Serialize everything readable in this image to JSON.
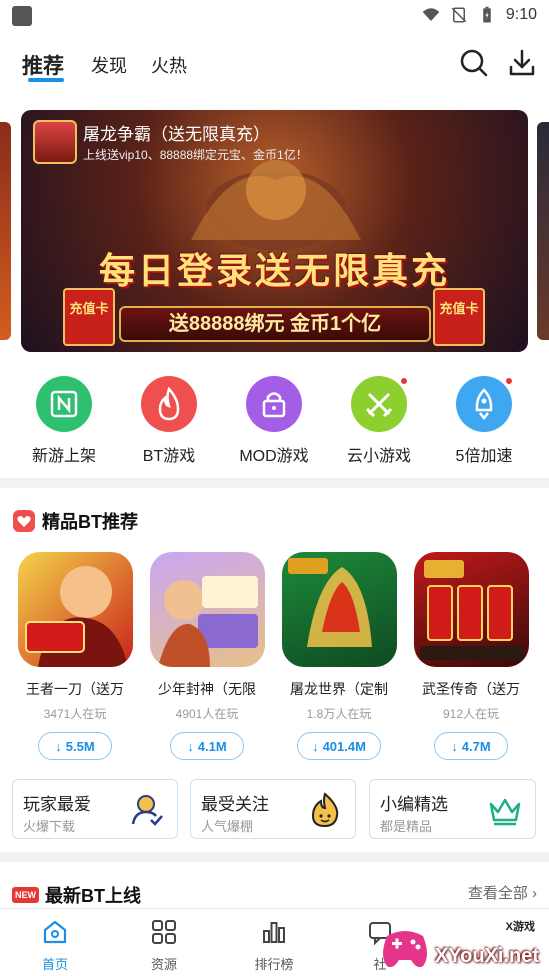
{
  "status_bar": {
    "time": "9:10",
    "icons": [
      "wifi-icon",
      "no-sim-icon",
      "battery-icon"
    ]
  },
  "top_nav": {
    "tabs": [
      {
        "label": "推荐",
        "active": true
      },
      {
        "label": "发现",
        "active": false
      },
      {
        "label": "火热",
        "active": false
      }
    ],
    "icons": [
      "search-icon",
      "download-icon"
    ]
  },
  "banner": {
    "title": "屠龙争霸（送无限真充）",
    "subtitle": "上线送vip10、88888绑定元宝、金币1亿！",
    "headline": "每日登录送无限真充",
    "strip_text": "送88888绑元 金币1个亿",
    "card_text": "充值卡"
  },
  "quick_entries": [
    {
      "label": "新游上架",
      "icon": "new-game-icon",
      "color": "#2fbf71",
      "dot": false
    },
    {
      "label": "BT游戏",
      "icon": "flame-icon",
      "color": "#ef4f4f",
      "dot": false
    },
    {
      "label": "MOD游戏",
      "icon": "lock-icon",
      "color": "#a45ee6",
      "dot": false
    },
    {
      "label": "云小游戏",
      "icon": "crossed-swords-icon",
      "color": "#8ccf2e",
      "dot": true
    },
    {
      "label": "5倍加速",
      "icon": "rocket-icon",
      "color": "#3fa7f2",
      "dot": true
    }
  ],
  "bt_section": {
    "title": "精品BT推荐",
    "games": [
      {
        "name": "王者一刀（送万",
        "players": "3471人在玩",
        "size": "5.5M",
        "colors": [
          "#f4d34a",
          "#c9231b"
        ]
      },
      {
        "name": "少年封神（无限",
        "players": "4901人在玩",
        "size": "4.1M",
        "colors": [
          "#c9a6f2",
          "#e6c08a"
        ]
      },
      {
        "name": "屠龙世界（定制",
        "players": "1.8万人在玩",
        "size": "401.4M",
        "colors": [
          "#1d8a3a",
          "#0f4a22"
        ]
      },
      {
        "name": "武圣传奇（送万",
        "players": "912人在玩",
        "size": "4.7M",
        "colors": [
          "#c01a1a",
          "#3a0a08"
        ]
      }
    ]
  },
  "feature_cards": [
    {
      "title": "玩家最爱",
      "sub": "火爆下载",
      "icon": "user-check-icon"
    },
    {
      "title": "最受关注",
      "sub": "人气爆棚",
      "icon": "smiley-flame-icon"
    },
    {
      "title": "小编精选",
      "sub": "都是精品",
      "icon": "crown-icon"
    }
  ],
  "latest_section": {
    "badge": "NEW",
    "title": "最新BT上线",
    "more": "查看全部"
  },
  "bottom_nav": [
    {
      "label": "首页",
      "icon": "home-icon",
      "active": true
    },
    {
      "label": "资源",
      "icon": "grid-icon",
      "active": false
    },
    {
      "label": "排行榜",
      "icon": "bar-chart-icon",
      "active": false
    },
    {
      "label": "社",
      "icon": "community-icon",
      "active": false
    }
  ],
  "watermark": {
    "small": "X游戏",
    "text": "XYouXi.net"
  },
  "colors": {
    "accent": "#1a8fe6",
    "badge_red": "#e53935"
  }
}
